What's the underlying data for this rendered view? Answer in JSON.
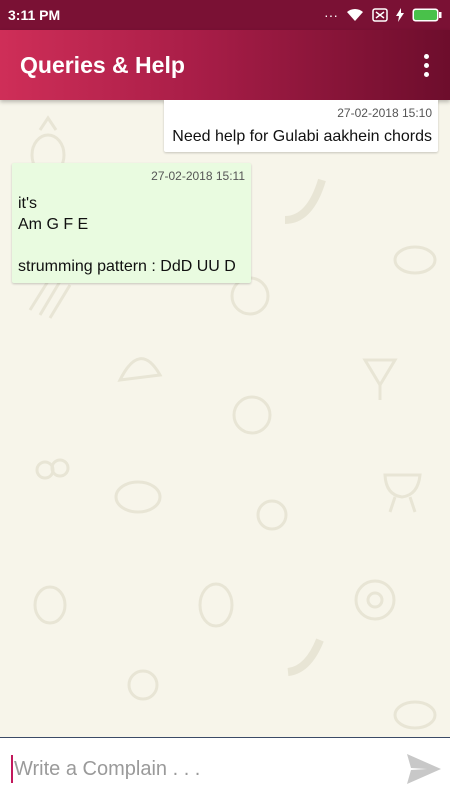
{
  "status_bar": {
    "time": "3:11 PM",
    "dots": "···"
  },
  "appbar": {
    "title": "Queries & Help"
  },
  "messages": [
    {
      "direction": "outgoing",
      "timestamp": "27-02-2018 15:10",
      "text": "Need help for Gulabi aakhein chords"
    },
    {
      "direction": "incoming",
      "timestamp": "27-02-2018 15:11",
      "text": "it's\nAm G F E\n\nstrumming pattern : DdD UU D"
    }
  ],
  "composer": {
    "placeholder": "Write a Complain . . ."
  },
  "colors": {
    "appbar_start": "#cf2e58",
    "appbar_end": "#6d0d2c",
    "incoming_bubble": "#e9fbe0",
    "background": "#f7f5ea"
  }
}
